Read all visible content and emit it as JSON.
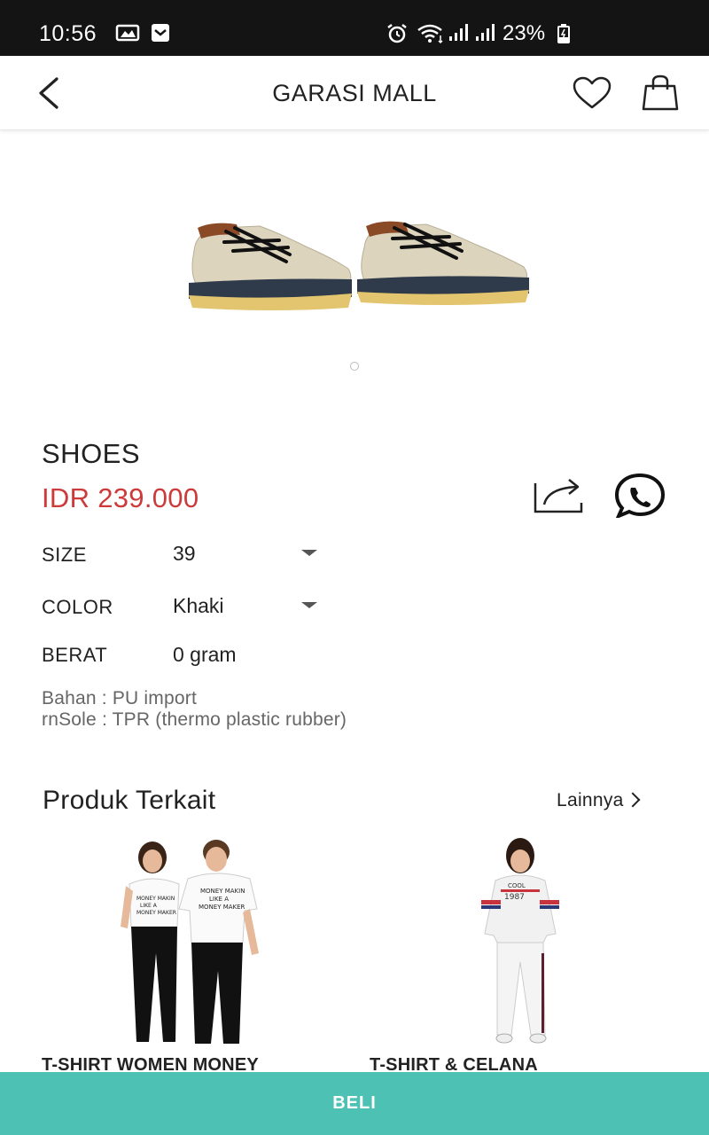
{
  "status_bar": {
    "time": "10:56",
    "battery": "23%"
  },
  "header": {
    "title": "GARASI MALL"
  },
  "product": {
    "name": "SHOES",
    "price": "IDR 239.000",
    "attributes": [
      {
        "label": "SIZE",
        "value": "39"
      },
      {
        "label": "COLOR",
        "value": "Khaki"
      },
      {
        "label": "BERAT",
        "value": "0 gram"
      }
    ],
    "description_lines": [
      "Bahan : PU import",
      "rnSole : TPR (thermo plastic rubber)"
    ]
  },
  "related": {
    "title": "Produk Terkait",
    "see_more": "Lainnya",
    "items": [
      {
        "title": "T-SHIRT WOMEN MONEY"
      },
      {
        "title": "T-SHIRT & CELANA"
      }
    ]
  },
  "buy_button": {
    "label": "BELI"
  },
  "colors": {
    "status_bar": "#141414",
    "price": "#cc3a3a",
    "buy_bar": "#4ec1b5"
  }
}
